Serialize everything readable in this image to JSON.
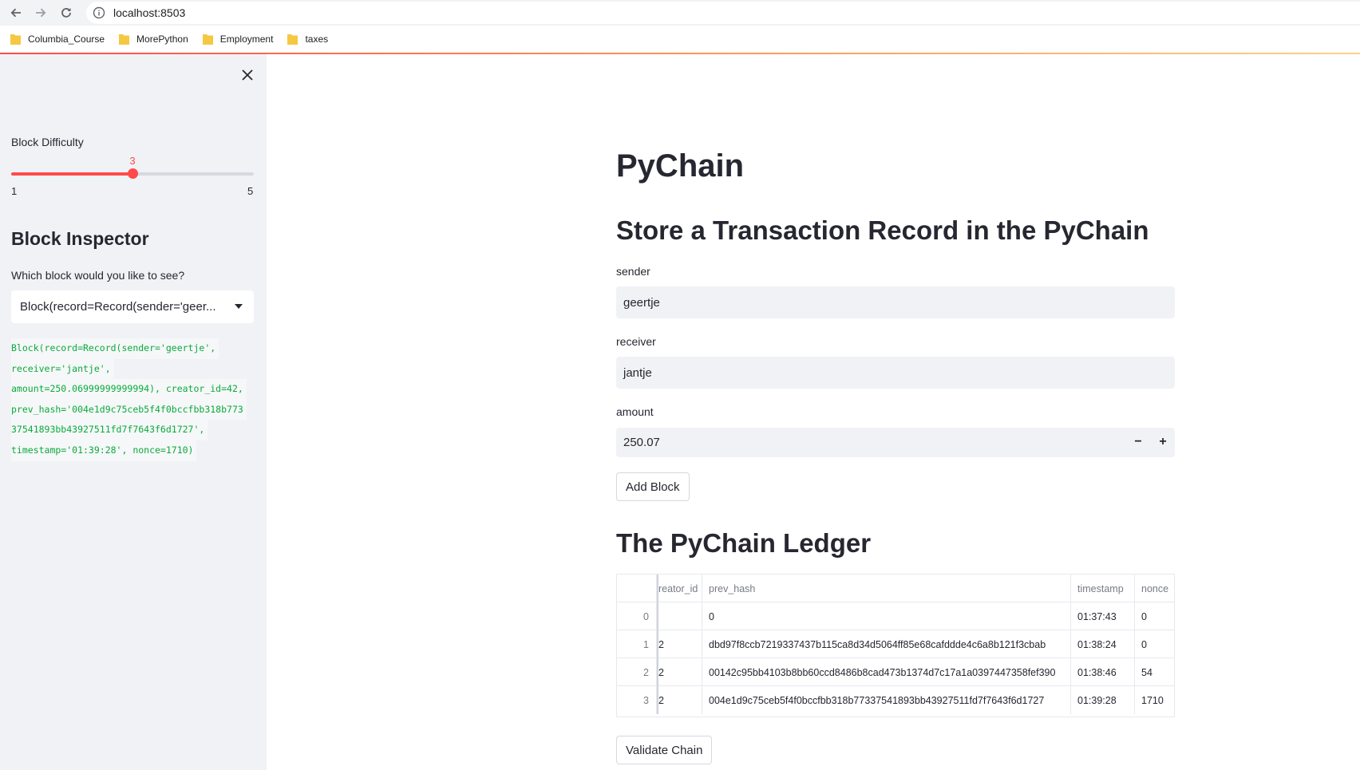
{
  "browser": {
    "url": "localhost:8503",
    "bookmarks": [
      "Columbia_Course",
      "MorePython",
      "Employment",
      "taxes"
    ]
  },
  "sidebar": {
    "difficulty_label": "Block Difficulty",
    "difficulty": {
      "value": 3,
      "min": 1,
      "max": 5,
      "value_text": "3",
      "min_text": "1",
      "max_text": "5"
    },
    "inspector_title": "Block Inspector",
    "select_label": "Which block would you like to see?",
    "select_value": "Block(record=Record(sender='geer...",
    "code_lines": [
      "Block(record=Record(sender='geertje',",
      "receiver='jantje',",
      "amount=250.06999999999994), creator_id=42,",
      "prev_hash='004e1d9c75ceb5f4f0bccfbb318b773",
      "37541893bb43927511fd7f7643f6d1727',",
      "timestamp='01:39:28', nonce=1710)"
    ]
  },
  "main": {
    "title": "PyChain",
    "store_heading": "Store a Transaction Record in the PyChain",
    "sender_label": "sender",
    "sender_value": "geertje",
    "receiver_label": "receiver",
    "receiver_value": "jantje",
    "amount_label": "amount",
    "amount_value": "250.07",
    "minus": "−",
    "plus": "+",
    "add_block": "Add Block",
    "ledger_heading": "The PyChain Ledger",
    "validate": "Validate Chain"
  },
  "ledger": {
    "columns": [
      "",
      "reator_id",
      "prev_hash",
      "timestamp",
      "nonce"
    ],
    "rows": [
      [
        "0",
        "",
        "0",
        "01:37:43",
        "0"
      ],
      [
        "1",
        "2",
        "dbd97f8ccb7219337437b115ca8d34d5064ff85e68cafddde4c6a8b121f3cbab",
        "01:38:24",
        "0"
      ],
      [
        "2",
        "2",
        "00142c95bb4103b8bb60ccd8486b8cad473b1374d7c17a1a0397447358fef390",
        "01:38:46",
        "54"
      ],
      [
        "3",
        "2",
        "004e1d9c75ceb5f4f0bccfbb318b77337541893bb43927511fd7f7643f6d1727",
        "01:39:28",
        "1710"
      ]
    ]
  },
  "colors": {
    "accent": "#ff4b4b",
    "code_green": "#09ab3b",
    "sidebar_bg": "#f0f2f6"
  }
}
